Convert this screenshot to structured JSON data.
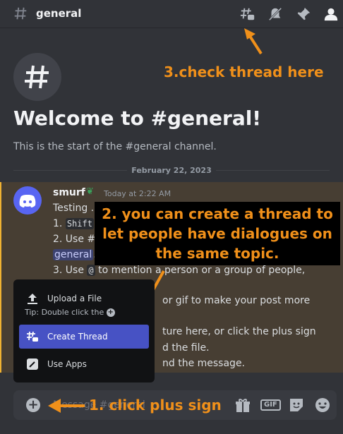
{
  "channel": {
    "name": "general"
  },
  "welcome": {
    "title": "Welcome to #general!",
    "subtitle": "This is the start of the #general channel."
  },
  "date_divider": "February 22, 2023",
  "message": {
    "author": "smurf",
    "timestamp": "Today at 2:22 AM",
    "lines": [
      "Testing ..",
      "1. ",
      "Shift",
      "2. Use #",
      "general",
      ".",
      "3. Use ",
      "@",
      " to mention a person or a group of people,",
      "or gif to make your post more",
      "ture here, or click the plus sign",
      "d the file.",
      "nd the message."
    ]
  },
  "popup_menu": {
    "items": [
      {
        "label": "Upload a File",
        "icon": "upload-icon"
      },
      {
        "label": "Create Thread",
        "icon": "thread-icon"
      },
      {
        "label": "Use Apps",
        "icon": "apps-icon"
      }
    ],
    "tip": "Tip: Double click the"
  },
  "composer": {
    "placeholder": "Message #general"
  },
  "composer_buttons": {
    "gif_label": "GIF"
  },
  "annotations": {
    "step1": "1. click plus sign",
    "step2": "2. you can create a thread to let people have dialogues on the same topic.",
    "step3": "3.check thread here"
  },
  "colors": {
    "background": "#313338",
    "accent": "#5865f2",
    "annotation": "#f0901a",
    "highlight": "#473e33"
  }
}
